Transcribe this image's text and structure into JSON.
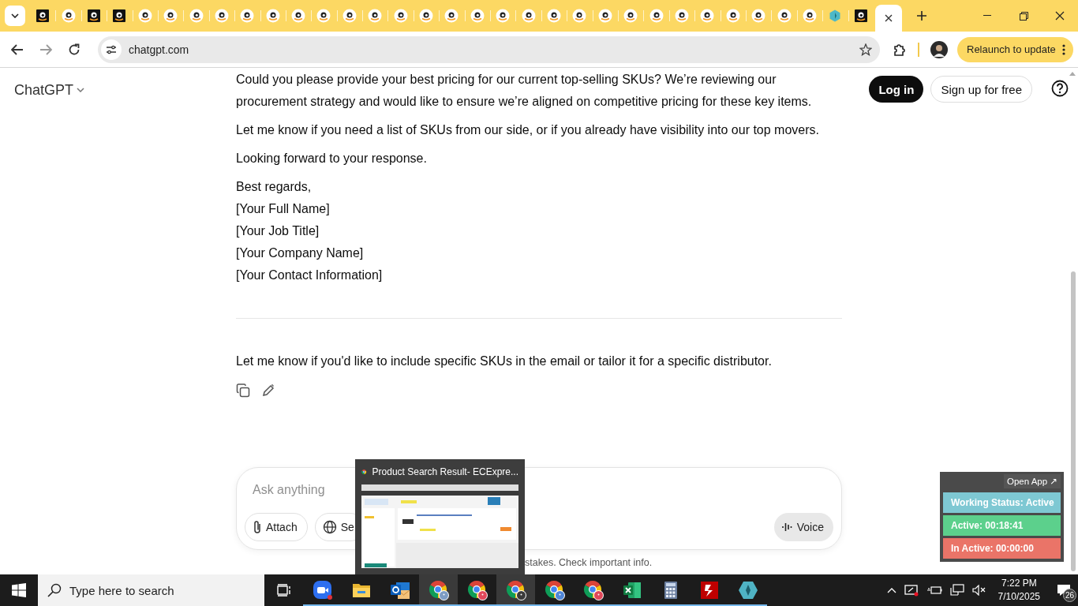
{
  "browser": {
    "tabs": [
      {
        "kind": "dark",
        "selected": false
      },
      {
        "kind": "light",
        "selected": false
      },
      {
        "kind": "dark",
        "selected": false
      },
      {
        "kind": "dark",
        "selected": false
      },
      {
        "kind": "light",
        "selected": false
      },
      {
        "kind": "light",
        "selected": false
      },
      {
        "kind": "light",
        "selected": false
      },
      {
        "kind": "light",
        "selected": false
      },
      {
        "kind": "light",
        "selected": false
      },
      {
        "kind": "light",
        "selected": false
      },
      {
        "kind": "light",
        "selected": false
      },
      {
        "kind": "light",
        "selected": false
      },
      {
        "kind": "light",
        "selected": false
      },
      {
        "kind": "light",
        "selected": false
      },
      {
        "kind": "light",
        "selected": false
      },
      {
        "kind": "light",
        "selected": false
      },
      {
        "kind": "light",
        "selected": false
      },
      {
        "kind": "light",
        "selected": false
      },
      {
        "kind": "light",
        "selected": false
      },
      {
        "kind": "light",
        "selected": false
      },
      {
        "kind": "light",
        "selected": false
      },
      {
        "kind": "light",
        "selected": false
      },
      {
        "kind": "light",
        "selected": false
      },
      {
        "kind": "light",
        "selected": false
      },
      {
        "kind": "light",
        "selected": false
      },
      {
        "kind": "light",
        "selected": false
      },
      {
        "kind": "light",
        "selected": false
      },
      {
        "kind": "light",
        "selected": false
      },
      {
        "kind": "light",
        "selected": false
      },
      {
        "kind": "light",
        "selected": false
      },
      {
        "kind": "light",
        "selected": false
      },
      {
        "kind": "hex",
        "selected": false
      },
      {
        "kind": "dark",
        "selected": false
      },
      {
        "kind": "blank",
        "selected": true
      }
    ],
    "address": "chatgpt.com",
    "relaunch_button": "Relaunch to update"
  },
  "header": {
    "title": "ChatGPT",
    "login": "Log in",
    "signup": "Sign up for free"
  },
  "message": {
    "paragraphs": [
      "Could you please provide your best pricing for our current top-selling SKUs? We’re reviewing our procurement strategy and would like to ensure we’re aligned on competitive pricing for these key items.",
      "Let me know if you need a list of SKUs from our side, or if you already have visibility into our top movers.",
      "Looking forward to your response."
    ],
    "signature": [
      "Best regards,",
      "[Your Full Name]",
      "[Your Job Title]",
      "[Your Company Name]",
      "[Your Contact Information]"
    ],
    "follow_up": "Let me know if you'd like to include specific SKUs in the email or tailor it for a specific distributor."
  },
  "composer": {
    "placeholder": "Ask anything",
    "attach": "Attach",
    "search": "Se",
    "voice": "Voice"
  },
  "disclaimer": "stakes. Check important info.",
  "preview": {
    "title": "Product Search Result- ECExpre..."
  },
  "tracker": {
    "open_app": "Open App ↗",
    "rows": [
      {
        "label": "Working Status: Active",
        "color": "#7ec8d3"
      },
      {
        "label": "Active: 00:18:41",
        "color": "#5cd08c"
      },
      {
        "label": "In Active: 00:00:00",
        "color": "#ea7468"
      }
    ]
  },
  "taskbar": {
    "search_placeholder": "Type here to search",
    "apps": [
      {
        "kind": "zoom",
        "selected": false
      },
      {
        "kind": "folder",
        "selected": false
      },
      {
        "kind": "outlook",
        "selected": false
      },
      {
        "kind": "chrome",
        "color": "#7d9cc4",
        "selected": true
      },
      {
        "kind": "chrome",
        "color": "#e0485a",
        "selected": false
      },
      {
        "kind": "chrome",
        "color": "#3b3b3b",
        "selected": true
      },
      {
        "kind": "chrome",
        "color": "#4f86d8",
        "selected": false
      },
      {
        "kind": "chrome",
        "color": "#e0485a",
        "selected": false
      },
      {
        "kind": "excel",
        "selected": false
      },
      {
        "kind": "calculator",
        "selected": false
      },
      {
        "kind": "filezilla",
        "selected": false
      },
      {
        "kind": "hexapp",
        "selected": false
      }
    ],
    "time": "7:22 PM",
    "date": "7/10/2025",
    "notifications": "26"
  }
}
